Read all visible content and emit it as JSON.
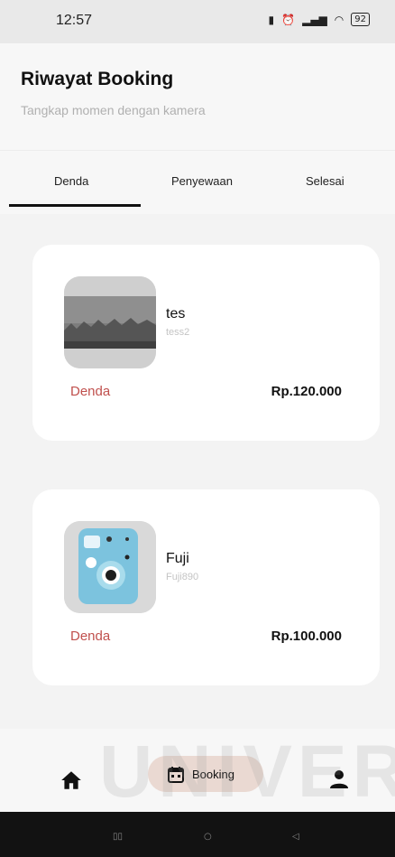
{
  "statusbar": {
    "time": "12:57",
    "battery": "92"
  },
  "header": {
    "title": "Riwayat Booking",
    "subtitle": "Tangkap momen dengan kamera"
  },
  "tabs": [
    {
      "label": "Denda",
      "selected": true
    },
    {
      "label": "Penyewaan",
      "selected": false
    },
    {
      "label": "Selesai",
      "selected": false
    }
  ],
  "bookings": [
    {
      "name": "tes",
      "code": "tess2",
      "status": "Denda",
      "price": "Rp.120.000",
      "image": "foggy-forest-photo"
    },
    {
      "name": "Fuji",
      "code": "Fuji890",
      "status": "Denda",
      "price": "Rp.100.000",
      "image": "instax-camera-blue"
    }
  ],
  "bottom_nav": {
    "home_icon": "home-icon",
    "booking_label": "Booking",
    "booking_icon": "calendar-icon",
    "profile_icon": "user-icon",
    "active_bg": "#ead9d2"
  },
  "watermark": "UNIVERSI",
  "colors": {
    "status_red": "#c0504d",
    "background": "#f7f7f7"
  }
}
